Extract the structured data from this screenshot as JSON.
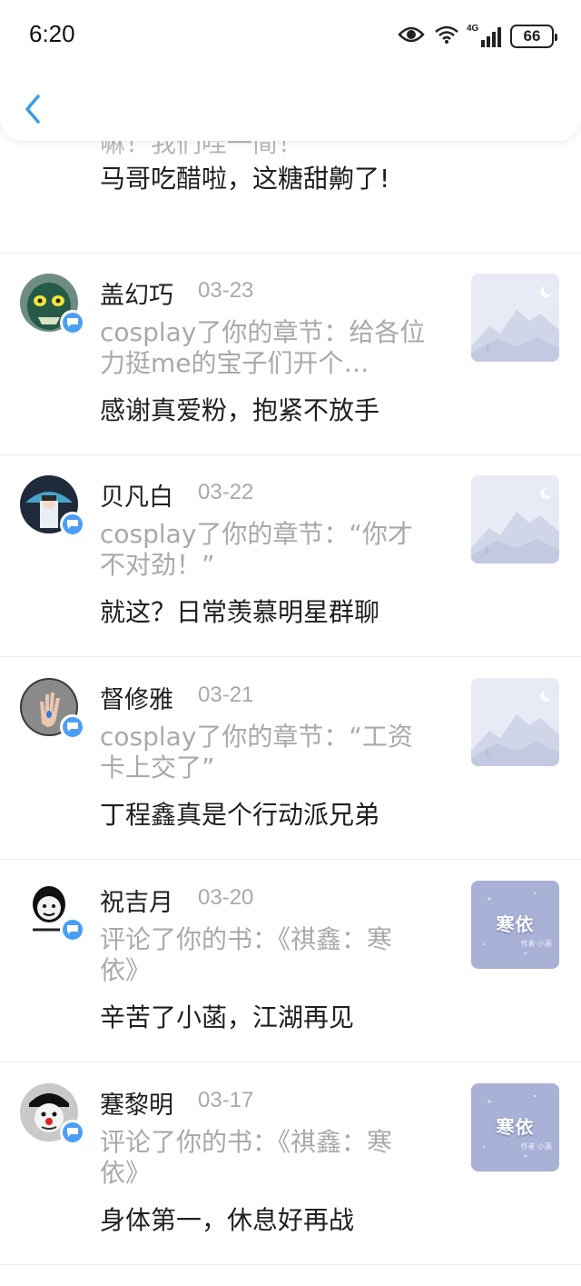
{
  "status_bar": {
    "time": "6:20",
    "battery": "66",
    "network": "4G"
  },
  "partial_item": {
    "hidden_text": "嘛！我们哇一简！",
    "content": "马哥吃醋啦，这糖甜齁了!"
  },
  "items": [
    {
      "name": "盖幻巧",
      "date": "03-23",
      "action": "cosplay了你的章节：给各位力挺me的宝子们开个…",
      "content": "感谢真爱粉，抱紧不放手",
      "avatar": "green-mask-avatar",
      "thumb": "placeholder-mountain"
    },
    {
      "name": "贝凡白",
      "date": "03-22",
      "action": "cosplay了你的章节：“你才不对劲！”",
      "content": "就这？日常羡慕明星群聊",
      "avatar": "boy-umbrella-avatar",
      "thumb": "placeholder-mountain"
    },
    {
      "name": "督修雅",
      "date": "03-21",
      "action": "cosplay了你的章节：“工资卡上交了”",
      "content": "丁程鑫真是个行动派兄弟",
      "avatar": "hand-avatar",
      "thumb": "placeholder-mountain"
    },
    {
      "name": "祝吉月",
      "date": "03-20",
      "action": "评论了你的书：《祺鑫：寒依》",
      "content": "辛苦了小菡，江湖再见",
      "avatar": "meme-cartoon-avatar",
      "thumb": "book-cover",
      "thumb_label": "寒依",
      "thumb_sub": "作者·小菡"
    },
    {
      "name": "蹇黎明",
      "date": "03-17",
      "action": "评论了你的书：《祺鑫：寒依》",
      "content": "身体第一，休息好再战",
      "avatar": "clown-avatar",
      "thumb": "book-cover",
      "thumb_label": "寒依",
      "thumb_sub": "作者·小菡"
    }
  ],
  "colors": {
    "accent": "#4a9ff5",
    "secondary_text": "#a9a9a9",
    "primary_text": "#1f1f1f",
    "divider": "#ececec",
    "book_cover": "#a9b1d6"
  }
}
